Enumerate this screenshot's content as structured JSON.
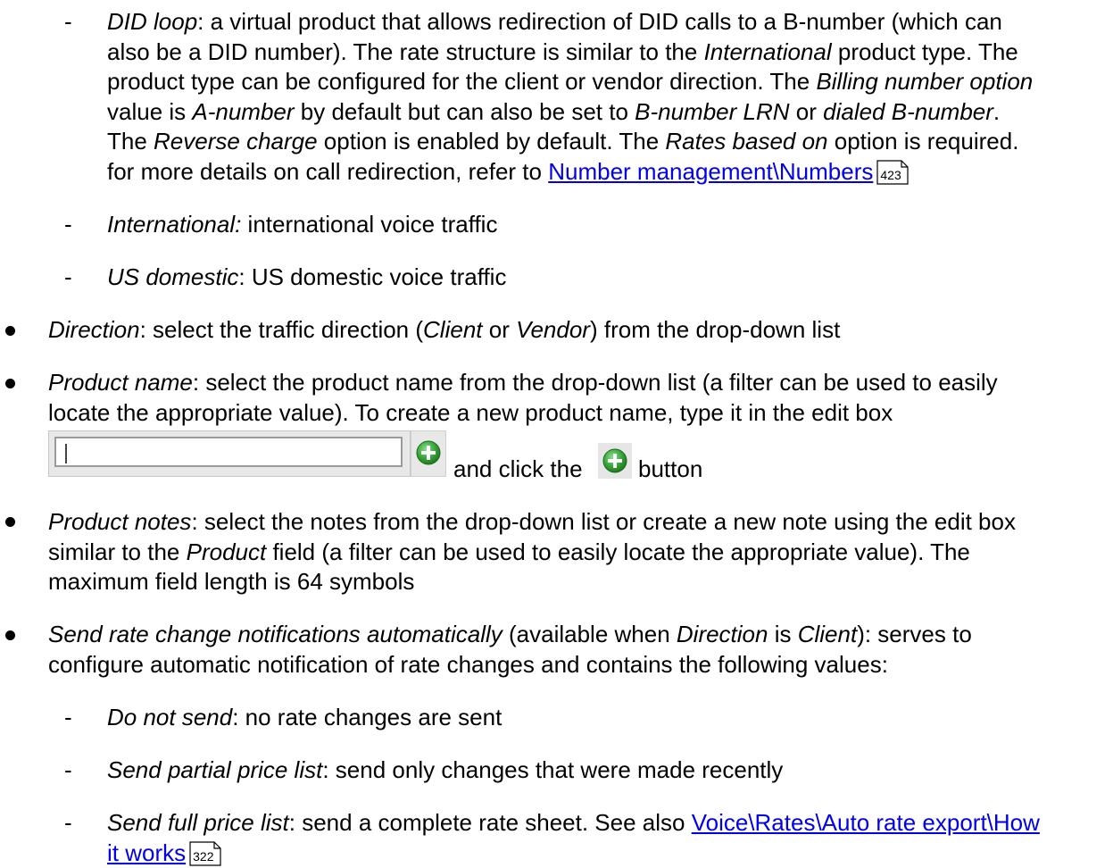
{
  "did_loop": {
    "term": "DID loop",
    "l1_a": ": a virtual product that allows redirection of DID calls to a B-number (which can",
    "l2_a": "also be a DID number). The rate structure is similar to the ",
    "l2_b": "International",
    "l2_c": " product type. The",
    "l3_a": "product type can be configured for the client or vendor direction. The ",
    "l3_b": "Billing number option",
    "l4_a": "value is ",
    "l4_b": "A-number",
    "l4_c": " by default but can also be set to ",
    "l4_d": "B-number LRN",
    "l4_e": " or ",
    "l4_f": "dialed B-number",
    "l4_g": ".",
    "l5_a": "The ",
    "l5_b": "Reverse charge",
    "l5_c": " option is enabled by default. The ",
    "l5_d": "Rates based on",
    "l5_e": " option is required.",
    "l6_a": "for more details on call redirection, refer to ",
    "link": "Number management\\Numbers",
    "page": "423"
  },
  "international": {
    "term": "International:",
    "text": " international voice traffic"
  },
  "us_domestic": {
    "term": "US domestic",
    "text": ": US domestic voice traffic"
  },
  "direction": {
    "term": "Direction",
    "a": ": select the traffic direction (",
    "b": "Client",
    "c": " or ",
    "d": "Vendor",
    "e": ") from the drop-down list"
  },
  "product_name": {
    "term": "Product name",
    "l1": ": select the product name from the drop-down list (a filter can be used to easily",
    "l2": "locate the appropriate value). To create a new product name, type it in the edit box",
    "and_click": "and click the",
    "button_word": "button"
  },
  "product_notes": {
    "term": "Product notes",
    "l1": ": select the notes from the drop-down list or create a new note using the edit box",
    "l2_a": "similar to the ",
    "l2_b": "Product",
    "l2_c": " field (a filter can be used to easily locate the appropriate value). The",
    "l3": "maximum field length is 64 symbols"
  },
  "send_rate": {
    "term": "Send rate change notifications automatically",
    "a": " (available when ",
    "b": "Direction",
    "c": " is ",
    "d": "Client",
    "e": "): serves to",
    "l2": "configure automatic notification of rate changes and contains the following values:"
  },
  "do_not_send": {
    "term": "Do not send",
    "text": ": no rate changes are sent"
  },
  "send_partial": {
    "term": "Send partial price list",
    "text": ": send only changes that were made recently"
  },
  "send_full": {
    "term": "Send full price list",
    "text": ": send a complete rate sheet. See also ",
    "link_l1": "Voice\\Rates\\Auto rate export\\How",
    "link_l2": "it works",
    "page": "322"
  },
  "colors": {
    "text": "#000000",
    "link": "#0000ee",
    "plus_green": "#3aa53a"
  },
  "icons": {
    "add": "green-plus-circle-icon",
    "pageref": "page-reference-icon"
  }
}
